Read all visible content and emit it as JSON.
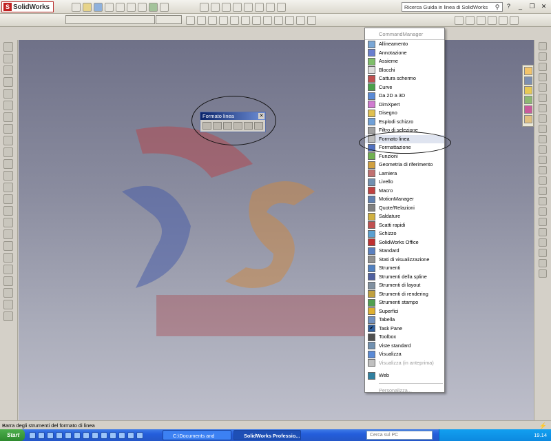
{
  "app": {
    "title": "SolidWorks"
  },
  "search": {
    "placeholder": "Ricerca Guida in linea di SolidWorks"
  },
  "floating_toolbar": {
    "title": "Formato linea"
  },
  "menu": {
    "title": "CommandManager",
    "items": [
      "Allineamento",
      "Annotazione",
      "Assieme",
      "Blocchi",
      "Cattura schermo",
      "Curve",
      "Da 2D a 3D",
      "DimXpert",
      "Disegno",
      "Esplodi schizzo",
      "Filtro di selezione",
      "Formato linea",
      "Formattazione",
      "Funzioni",
      "Geometria di riferimento",
      "Lamiera",
      "Livello",
      "Macro",
      "MotionManager",
      "Quote/Relazioni",
      "Saldature",
      "Scatti rapidi",
      "Schizzo",
      "SolidWorks Office",
      "Standard",
      "Stati di visualizzazione",
      "Strumenti",
      "Strumenti della spline",
      "Strumenti di layout",
      "Strumenti di rendering",
      "Strumenti stampo",
      "Superfici",
      "Tabella",
      "Task Pane",
      "Toolbox",
      "Viste standard",
      "Visualizza",
      "Visualizza (in anteprima)",
      "Web"
    ],
    "footer": "Personalizza..."
  },
  "status": {
    "text": "Barra degli strumenti del formato di linea"
  },
  "taskbar": {
    "start": "Start",
    "btn1": "C:\\Documents and Settin...",
    "btn2": "SolidWorks Professio...",
    "search": "Cerca sul PC",
    "clock": "19.14"
  },
  "colors": {
    "accent": "#0a246a",
    "canvas": "#8a8c9f"
  }
}
